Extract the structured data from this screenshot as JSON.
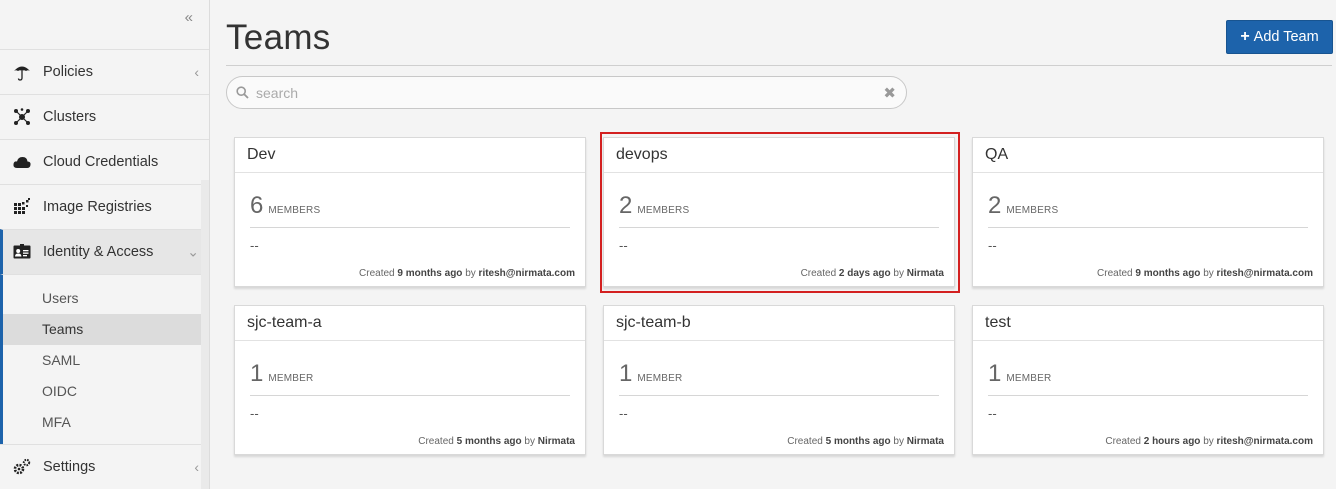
{
  "sidebar": {
    "collapse_glyph": "«",
    "items": [
      {
        "label": "Policies",
        "icon": "umbrella-icon",
        "has_chevron": true
      },
      {
        "label": "Clusters",
        "icon": "cluster-nodes-icon",
        "has_chevron": false
      },
      {
        "label": "Cloud Credentials",
        "icon": "cloud-icon",
        "has_chevron": false
      },
      {
        "label": "Image Registries",
        "icon": "registry-grid-icon",
        "has_chevron": false
      },
      {
        "label": "Identity & Access",
        "icon": "id-card-icon",
        "has_chevron": true,
        "expanded": true
      }
    ],
    "subitems": [
      {
        "label": "Users"
      },
      {
        "label": "Teams",
        "active": true
      },
      {
        "label": "SAML"
      },
      {
        "label": "OIDC"
      },
      {
        "label": "MFA"
      }
    ],
    "settings": {
      "label": "Settings",
      "icon": "gears-icon"
    }
  },
  "header": {
    "title": "Teams",
    "add_button": "Add Team"
  },
  "search": {
    "placeholder": "search",
    "value": ""
  },
  "teams": [
    {
      "name": "Dev",
      "count": "6",
      "unit": "MEMBERS",
      "description": "--",
      "created_prefix": "Created",
      "created_when": "9 months ago",
      "by": "by",
      "creator": "ritesh@nirmata.com"
    },
    {
      "name": "devops",
      "count": "2",
      "unit": "MEMBERS",
      "description": "--",
      "created_prefix": "Created",
      "created_when": "2 days ago",
      "by": "by",
      "creator": "Nirmata",
      "highlighted": true
    },
    {
      "name": "QA",
      "count": "2",
      "unit": "MEMBERS",
      "description": "--",
      "created_prefix": "Created",
      "created_when": "9 months ago",
      "by": "by",
      "creator": "ritesh@nirmata.com"
    },
    {
      "name": "sjc-team-a",
      "count": "1",
      "unit": "MEMBER",
      "description": "--",
      "created_prefix": "Created",
      "created_when": "5 months ago",
      "by": "by",
      "creator": "Nirmata"
    },
    {
      "name": "sjc-team-b",
      "count": "1",
      "unit": "MEMBER",
      "description": "--",
      "created_prefix": "Created",
      "created_when": "5 months ago",
      "by": "by",
      "creator": "Nirmata"
    },
    {
      "name": "test",
      "count": "1",
      "unit": "MEMBER",
      "description": "--",
      "created_prefix": "Created",
      "created_when": "2 hours ago",
      "by": "by",
      "creator": "ritesh@nirmata.com"
    }
  ],
  "colors": {
    "accent": "#1d63ab",
    "highlight": "#d32020",
    "background": "#f4f4f4"
  }
}
